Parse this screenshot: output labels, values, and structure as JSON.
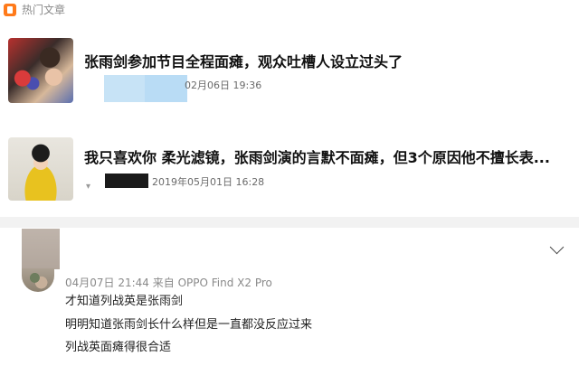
{
  "header": {
    "label": "热门文章"
  },
  "articles": [
    {
      "title": "张雨剑参加节目全程面瘫，观众吐槽人设立过头了",
      "date": "02月06日 19:36"
    },
    {
      "title": "我只喜欢你 柔光滤镜，张雨剑演的言默不面瘫，但3个原因他不擅长表...",
      "date": "2019年05月01日 16:28"
    }
  ],
  "comment": {
    "meta": "04月07日 21:44  来自 OPPO Find X2 Pro",
    "lines": [
      "才知道列战英是张雨剑",
      "明明知道张雨剑长什么样但是一直都没反应过来",
      "列战英面瘫得很合适"
    ]
  },
  "colors": {
    "hot_icon": "#ff7a1a",
    "separator": "#f2f2f2",
    "redaction_blue": "#c7e3f6"
  },
  "icons": {
    "hot": "hot-articles-icon",
    "chevron": "chevron-down-icon"
  }
}
